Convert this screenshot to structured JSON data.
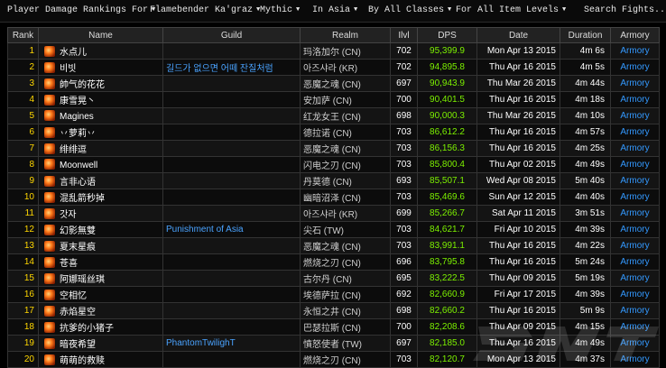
{
  "filters": {
    "title": "Player Damage Rankings For",
    "boss": "Flamebender Ka'graz",
    "difficulty": "Mythic",
    "region": "In Asia",
    "classes": "By All Classes",
    "itemlevel": "For All Item Levels",
    "search_placeholder": "Search Fights..."
  },
  "table": {
    "headers": [
      "Rank",
      "Name",
      "Guild",
      "Realm",
      "Ilvl",
      "DPS",
      "Date",
      "Duration",
      "Armory"
    ],
    "armory_label": "Armory",
    "rows": [
      {
        "rank": "1",
        "name": "水点儿",
        "guild": "",
        "realm": "玛洛加尔 (CN)",
        "ilvl": "702",
        "dps": "95,399.9",
        "date": "Mon Apr 13 2015",
        "duration": "4m 6s"
      },
      {
        "rank": "2",
        "name": "비빗",
        "guild": "길드가 없으면 어떼 잔질처럼",
        "realm": "아즈샤라 (KR)",
        "ilvl": "702",
        "dps": "94,895.8",
        "date": "Thu Apr 16 2015",
        "duration": "4m 5s"
      },
      {
        "rank": "3",
        "name": "帥气的花花",
        "guild": "",
        "realm": "恶魔之魂 (CN)",
        "ilvl": "697",
        "dps": "90,943.9",
        "date": "Thu Mar 26 2015",
        "duration": "4m 44s"
      },
      {
        "rank": "4",
        "name": "康雪晃丶",
        "guild": "",
        "realm": "安加萨 (CN)",
        "ilvl": "700",
        "dps": "90,401.5",
        "date": "Thu Apr 16 2015",
        "duration": "4m 18s"
      },
      {
        "rank": "5",
        "name": "Magines",
        "guild": "",
        "realm": "红龙女王 (CN)",
        "ilvl": "698",
        "dps": "90,000.3",
        "date": "Thu Mar 26 2015",
        "duration": "4m 10s"
      },
      {
        "rank": "6",
        "name": "丷萝莉丷",
        "guild": "",
        "realm": "德拉诺 (CN)",
        "ilvl": "703",
        "dps": "86,612.2",
        "date": "Thu Apr 16 2015",
        "duration": "4m 57s"
      },
      {
        "rank": "7",
        "name": "绯绯逗",
        "guild": "",
        "realm": "恶魔之魂 (CN)",
        "ilvl": "703",
        "dps": "86,156.3",
        "date": "Thu Apr 16 2015",
        "duration": "4m 25s"
      },
      {
        "rank": "8",
        "name": "Moonwell",
        "guild": "",
        "realm": "闪电之刃 (CN)",
        "ilvl": "703",
        "dps": "85,800.4",
        "date": "Thu Apr 02 2015",
        "duration": "4m 49s"
      },
      {
        "rank": "9",
        "name": "言非心语",
        "guild": "",
        "realm": "丹莫德 (CN)",
        "ilvl": "693",
        "dps": "85,507.1",
        "date": "Wed Apr 08 2015",
        "duration": "5m 40s"
      },
      {
        "rank": "10",
        "name": "混乱箭秒掉",
        "guild": "",
        "realm": "幽暗沼泽 (CN)",
        "ilvl": "703",
        "dps": "85,469.6",
        "date": "Sun Apr 12 2015",
        "duration": "4m 40s"
      },
      {
        "rank": "11",
        "name": "갓자",
        "guild": "",
        "realm": "아즈샤라 (KR)",
        "ilvl": "699",
        "dps": "85,266.7",
        "date": "Sat Apr 11 2015",
        "duration": "3m 51s"
      },
      {
        "rank": "12",
        "name": "幻影無雙",
        "guild": "Punishment of Asia",
        "realm": "尖石 (TW)",
        "ilvl": "703",
        "dps": "84,621.7",
        "date": "Fri Apr 10 2015",
        "duration": "4m 39s"
      },
      {
        "rank": "13",
        "name": "夏末星痕",
        "guild": "",
        "realm": "恶魔之魂 (CN)",
        "ilvl": "703",
        "dps": "83,991.1",
        "date": "Thu Apr 16 2015",
        "duration": "4m 22s"
      },
      {
        "rank": "14",
        "name": "苍喜",
        "guild": "",
        "realm": "燃烧之刃 (CN)",
        "ilvl": "696",
        "dps": "83,795.8",
        "date": "Thu Apr 16 2015",
        "duration": "5m 24s"
      },
      {
        "rank": "15",
        "name": "阿娜瑶丝琪",
        "guild": "",
        "realm": "古尔丹 (CN)",
        "ilvl": "695",
        "dps": "83,222.5",
        "date": "Thu Apr 09 2015",
        "duration": "5m 19s"
      },
      {
        "rank": "16",
        "name": "空相忆",
        "guild": "",
        "realm": "埃德萨拉 (CN)",
        "ilvl": "692",
        "dps": "82,660.9",
        "date": "Fri Apr 17 2015",
        "duration": "4m 39s"
      },
      {
        "rank": "17",
        "name": "赤焰星空",
        "guild": "",
        "realm": "永恒之井 (CN)",
        "ilvl": "698",
        "dps": "82,660.2",
        "date": "Thu Apr 16 2015",
        "duration": "5m 9s"
      },
      {
        "rank": "18",
        "name": "抗爹的小猪子",
        "guild": "",
        "realm": "巴瑟拉斯 (CN)",
        "ilvl": "700",
        "dps": "82,208.6",
        "date": "Thu Apr 09 2015",
        "duration": "4m 15s"
      },
      {
        "rank": "19",
        "name": "暗夜希望",
        "guild": "PhantomTwilighT",
        "realm": "憤怒使者 (TW)",
        "ilvl": "697",
        "dps": "82,185.0",
        "date": "Thu Apr 16 2015",
        "duration": "4m 49s"
      },
      {
        "rank": "20",
        "name": "萌萌的救赎",
        "guild": "",
        "realm": "燃烧之刃 (CN)",
        "ilvl": "703",
        "dps": "82,120.7",
        "date": "Mon Apr 13 2015",
        "duration": "4m 37s"
      }
    ]
  },
  "colors": {
    "rank_gold": "#ffd700",
    "dps_green": "#7cf000",
    "guild_blue": "#4aa3ff",
    "armory_blue": "#3399ff"
  },
  "icons": {
    "class_icon": "class-spec-icon"
  }
}
